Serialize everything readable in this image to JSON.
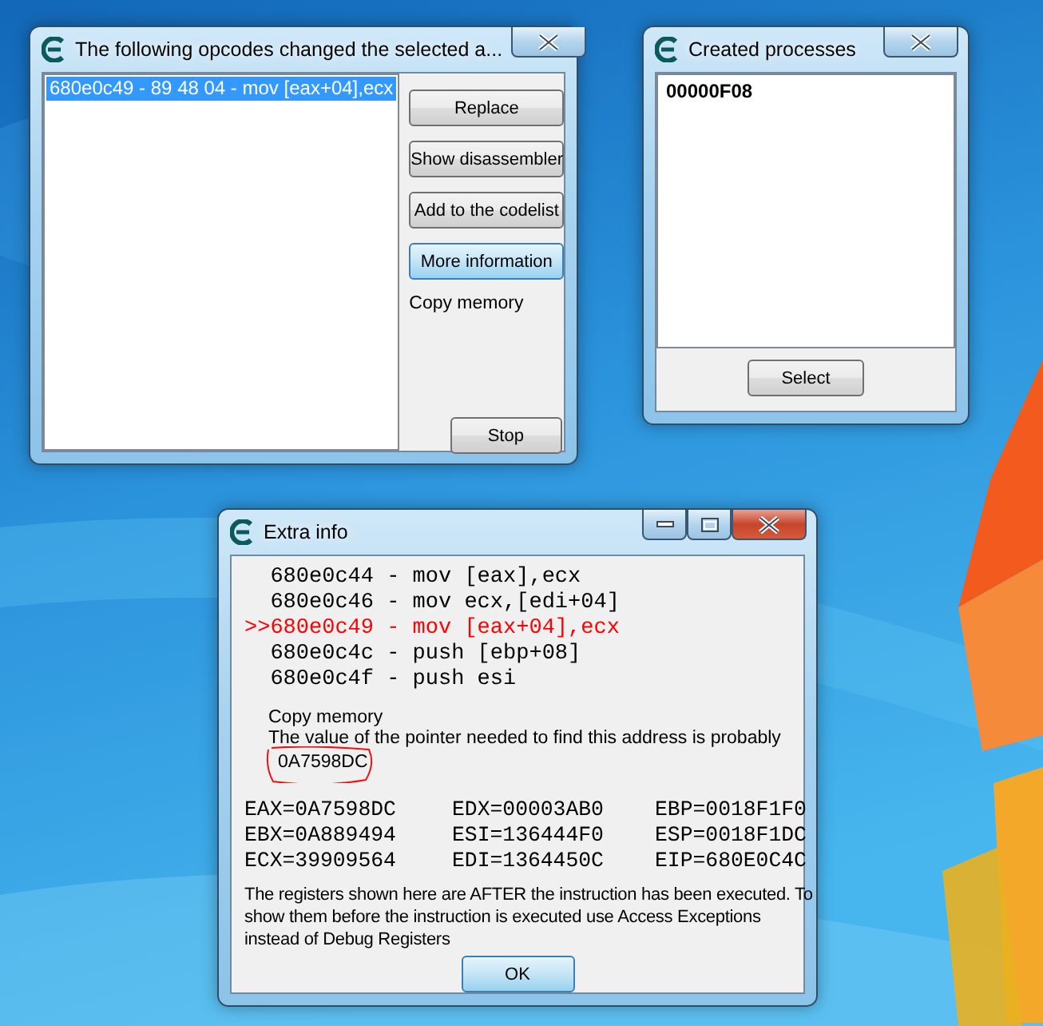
{
  "opcodes_window": {
    "title": "The following opcodes changed the selected a...",
    "entries": [
      {
        "text": "680e0c49 - 89 48 04 - mov [eax+04],ecx",
        "selected": true
      }
    ],
    "buttons": [
      {
        "label": "Replace",
        "focused": false
      },
      {
        "label": "Show disassembler",
        "focused": false
      },
      {
        "label": "Add to the codelist",
        "focused": false
      },
      {
        "label": "More information",
        "focused": true
      }
    ],
    "note": "Copy memory",
    "stop_button": "Stop"
  },
  "processes_window": {
    "title": "Created processes",
    "processes": [
      {
        "text": "00000F08",
        "selected": false
      }
    ],
    "button": "Select"
  },
  "extra_info_window": {
    "title": "Extra info",
    "disassembly": [
      {
        "text": "680e0c44 - mov [eax],ecx",
        "current": false
      },
      {
        "text": "680e0c46 - mov ecx,[edi+04]",
        "current": false
      },
      {
        "marker": ">>",
        "text": "680e0c49 - mov [eax+04],ecx",
        "current": true
      },
      {
        "text": "680e0c4c - push [ebp+08]",
        "current": false
      },
      {
        "text": "680e0c4f - push esi",
        "current": false
      }
    ],
    "note": "Copy memory",
    "pointer_text": "The value of the pointer needed to find this address is probably",
    "pointer_value": "0A7598DC",
    "registers": [
      "EAX=0A7598DC",
      "EDX=00003AB0",
      "EBP=0018F1F0",
      "EBX=0A889494",
      "ESI=136444F0",
      "ESP=0018F1DC",
      "ECX=39909564",
      "EDI=1364450C",
      "EIP=680E0C4C"
    ],
    "explanation": "The registers shown here are AFTER the instruction has been executed. To show them before the instruction is executed use Access Exceptions instead of Debug Registers",
    "button": "OK"
  }
}
